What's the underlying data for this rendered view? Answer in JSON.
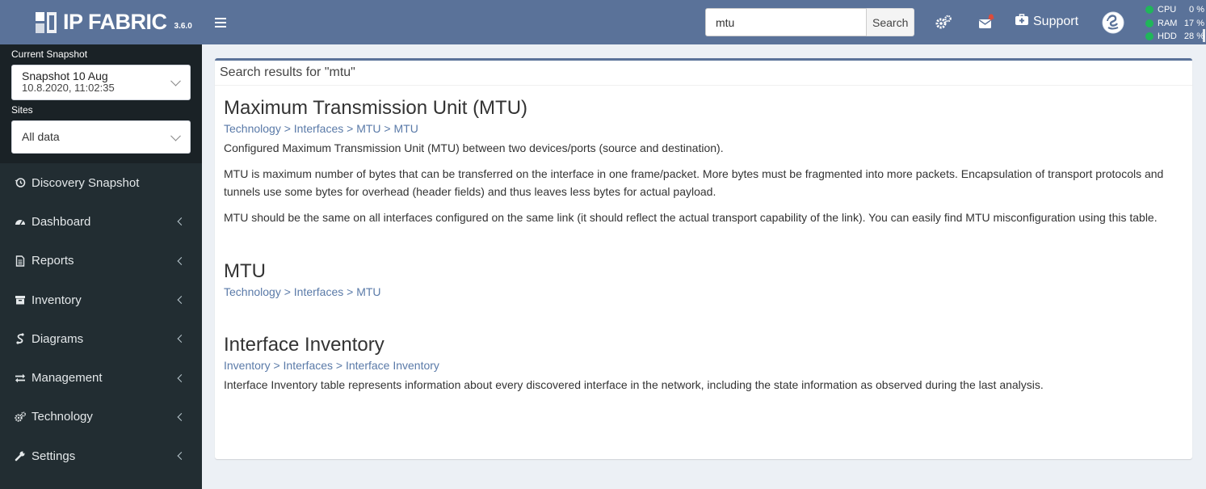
{
  "brand": {
    "name": "IP FABRIC",
    "version": "3.6.0"
  },
  "snapshot": {
    "label": "Current Snapshot",
    "title": "Snapshot 10 Aug",
    "datetime": "10.8.2020, 11:02:35",
    "sites_label": "Sites",
    "sites_value": "All data"
  },
  "nav": [
    {
      "label": "Discovery Snapshot",
      "icon": "history-icon",
      "has_arrow": false
    },
    {
      "label": "Dashboard",
      "icon": "dashboard-icon",
      "has_arrow": true
    },
    {
      "label": "Reports",
      "icon": "report-icon",
      "has_arrow": true
    },
    {
      "label": "Inventory",
      "icon": "archive-icon",
      "has_arrow": true
    },
    {
      "label": "Diagrams",
      "icon": "diagram-icon",
      "has_arrow": true
    },
    {
      "label": "Management",
      "icon": "exchange-icon",
      "has_arrow": true
    },
    {
      "label": "Technology",
      "icon": "cogs-icon",
      "has_arrow": true
    },
    {
      "label": "Settings",
      "icon": "wrench-icon",
      "has_arrow": true
    }
  ],
  "header": {
    "search_value": "mtu",
    "search_button": "Search",
    "support_label": "Support",
    "stats": [
      {
        "name": "CPU",
        "value": "0 %"
      },
      {
        "name": "RAM",
        "value": "17 %"
      },
      {
        "name": "HDD",
        "value": "28 %"
      }
    ],
    "status_color": "#20b65a",
    "accent": "#5a7299"
  },
  "results": {
    "heading": "Search results for \"mtu\"",
    "items": [
      {
        "title": "Maximum Transmission Unit (MTU)",
        "path": "Technology > Interfaces > MTU > MTU",
        "desc": [
          "Configured Maximum Transmission Unit (MTU) between two devices/ports (source and destination).",
          "MTU is maximum number of bytes that can be transferred on the interface in one frame/packet. More bytes must be fragmented into more packets. Encapsulation of transport protocols and tunnels use some bytes for overhead (header fields) and thus leaves less bytes for actual payload.",
          "MTU should be the same on all interfaces configured on the same link (it should reflect the actual transport capability of the link). You can easily find MTU misconfiguration using this table."
        ]
      },
      {
        "title": "MTU",
        "path": "Technology > Interfaces > MTU",
        "desc": []
      },
      {
        "title": "Interface Inventory",
        "path": "Inventory > Interfaces > Interface Inventory",
        "desc": [
          "Interface Inventory table represents information about every discovered interface in the network, including the state information as observed during the last analysis."
        ]
      }
    ]
  }
}
